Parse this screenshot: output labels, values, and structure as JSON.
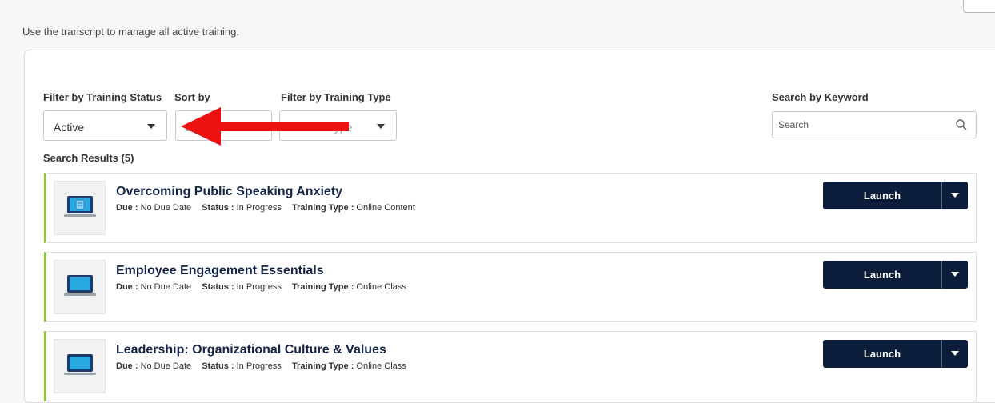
{
  "page": {
    "intro_text": "Use the transcript to manage all active training."
  },
  "filters": {
    "status_label": "Filter by Training Status",
    "status_value": "Active",
    "sort_label": "Sort by",
    "sort_value": "D",
    "type_label": "Filter by Training Type",
    "type_value": "Type",
    "search_label": "Search by Keyword",
    "search_placeholder": "Search"
  },
  "results": {
    "label": "Search Results (5)",
    "items": [
      {
        "title": "Overcoming Public Speaking Anxiety",
        "due_label": "Due :",
        "due_value": "No Due Date",
        "status_label": "Status :",
        "status_value": "In Progress",
        "type_label": "Training Type :",
        "type_value": "Online Content",
        "icon": "document-laptop-icon",
        "button": "Launch"
      },
      {
        "title": "Employee Engagement Essentials",
        "due_label": "Due :",
        "due_value": "No Due Date",
        "status_label": "Status :",
        "status_value": "In Progress",
        "type_label": "Training Type :",
        "type_value": "Online Class",
        "icon": "laptop-icon",
        "button": "Launch"
      },
      {
        "title": "Leadership: Organizational Culture & Values",
        "due_label": "Due :",
        "due_value": "No Due Date",
        "status_label": "Status :",
        "status_value": "In Progress",
        "type_label": "Training Type :",
        "type_value": "Online Class",
        "icon": "laptop-icon",
        "button": "Launch"
      }
    ]
  },
  "colors": {
    "accent_green": "#8dc63f",
    "launch_button": "#0b1d3a",
    "title_navy": "#14254a",
    "annotation_arrow": "#ee1111"
  }
}
